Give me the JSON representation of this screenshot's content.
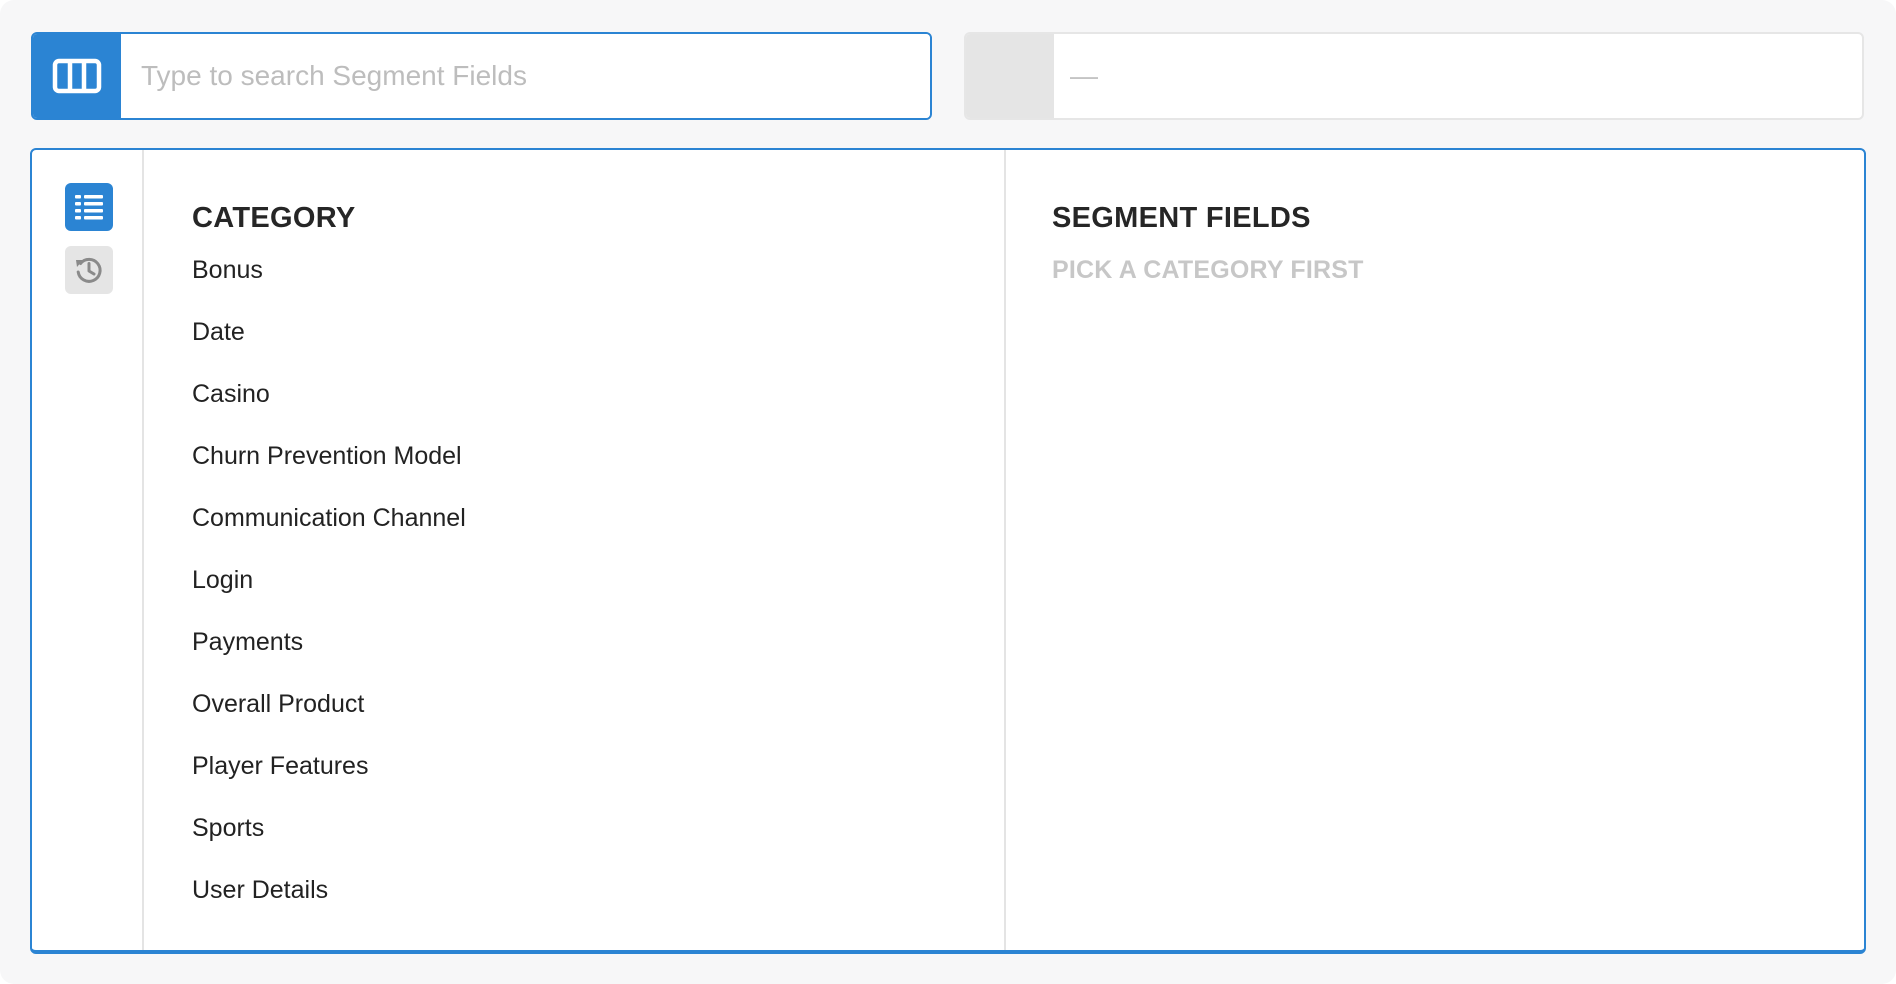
{
  "search": {
    "placeholder": "Type to search Segment Fields",
    "icon": "columns-icon",
    "accent_color": "#2b84d3"
  },
  "value_field": {
    "text": "—"
  },
  "rail": {
    "items": [
      {
        "icon": "list-icon",
        "active": true
      },
      {
        "icon": "history-icon",
        "active": false
      }
    ]
  },
  "category": {
    "title": "CATEGORY",
    "items": [
      "Bonus",
      "Date",
      "Casino",
      "Churn Prevention Model",
      "Communication Channel",
      "Login",
      "Payments",
      "Overall Product",
      "Player Features",
      "Sports",
      "User Details"
    ]
  },
  "segment_fields": {
    "title": "SEGMENT FIELDS",
    "hint": "PICK A CATEGORY FIRST"
  }
}
